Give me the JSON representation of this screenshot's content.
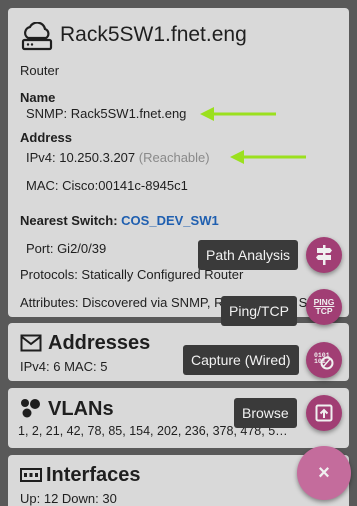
{
  "device": {
    "title": "Rack5SW1.fnet.eng",
    "type": "Router",
    "name_heading": "Name",
    "snmp": "SNMP:  Rack5SW1.fnet.eng",
    "address_heading": "Address",
    "ipv4_label": "IPv4:  10.250.3.207",
    "ipv4_status": "(Reachable)",
    "mac": "MAC:  Cisco:00141c-8945c1",
    "nearest_switch_label": "Nearest Switch:",
    "nearest_switch_value": "COS_DEV_SW1",
    "port": "Port:  Gi2/0/39",
    "protocols": "Protocols:  Statically Configured Router",
    "attributes": "Attributes:  Discovered via SNMP, Responded to S"
  },
  "addresses": {
    "title": "Addresses",
    "summary": "IPv4:  6    MAC:  5"
  },
  "vlans": {
    "title": "VLANs",
    "summary": "1, 2, 21, 42, 78, 85, 154, 202, 236, 378, 478, 5…"
  },
  "interfaces": {
    "title": "Interfaces",
    "summary": "Up: 12    Down: 30"
  },
  "fab_menu": {
    "path_analysis": "Path Analysis",
    "ping_tcp": "Ping/TCP",
    "ping_icon_text_top": "PING",
    "ping_icon_text_bottom": "TCP",
    "capture": "Capture (Wired)",
    "browse": "Browse",
    "close": "×"
  },
  "colors": {
    "accent": "#a13e74",
    "arrow": "#9be01e",
    "link": "#1f5fb0"
  }
}
